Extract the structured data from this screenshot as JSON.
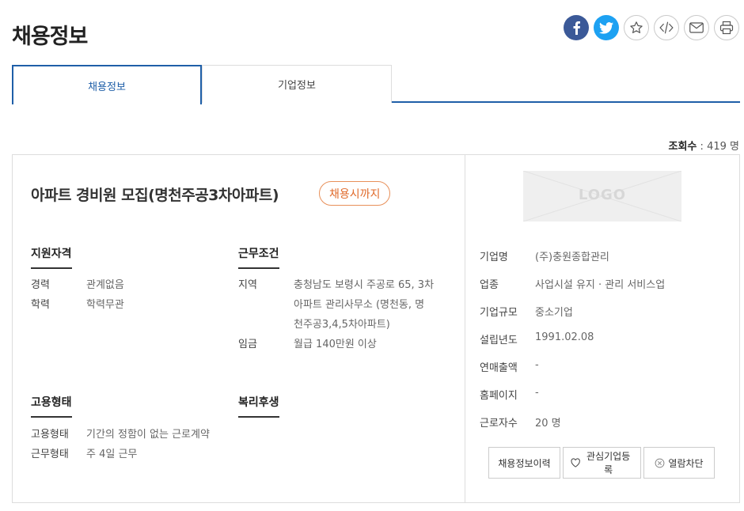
{
  "header": {
    "title": "채용정보"
  },
  "tabs": [
    {
      "label": "채용정보",
      "active": true
    },
    {
      "label": "기업정보",
      "active": false
    }
  ],
  "view_count": {
    "label": "조회수",
    "value": "419",
    "unit": "명"
  },
  "job": {
    "title": "아파트 경비원 모집(명천주공3차아파트)",
    "deadline_badge": "채용시까지"
  },
  "sections": {
    "qualification": {
      "heading": "지원자격",
      "rows": [
        {
          "key": "경력",
          "value": "관계없음"
        },
        {
          "key": "학력",
          "value": "학력무관"
        }
      ]
    },
    "conditions": {
      "heading": "근무조건",
      "rows": [
        {
          "key": "지역",
          "value_lines": [
            "충청남도 보령시 주공로 65, 3차",
            "아파트 관리사무소 (명천동, 명",
            "천주공3,4,5차아파트)"
          ]
        },
        {
          "key": "임금",
          "value": "월급 140만원 이상"
        }
      ]
    },
    "employment": {
      "heading": "고용형태",
      "rows": [
        {
          "key": "고용형태",
          "value": "기간의 정함이 없는 근로계약"
        },
        {
          "key": "근무형태",
          "value": "주 4일 근무"
        }
      ]
    },
    "welfare": {
      "heading": "복리후생"
    }
  },
  "company": {
    "logo_text": "LOGO",
    "rows": [
      {
        "key": "기업명",
        "value": "(주)충원종합관리"
      },
      {
        "key": "업종",
        "value": "사업시설 유지 · 관리 서비스업"
      },
      {
        "key": "기업규모",
        "value": "중소기업"
      },
      {
        "key": "설립년도",
        "value": "1991.02.08"
      },
      {
        "key": "연매출액",
        "value": "-"
      },
      {
        "key": "홈페이지",
        "value": "-"
      },
      {
        "key": "근로자수",
        "value": "20 명"
      }
    ],
    "buttons": {
      "history": "채용정보이력",
      "interest": "관심기업등록",
      "block": "열람차단"
    }
  },
  "colors": {
    "facebook": "#3b5998",
    "twitter": "#1da1f2",
    "tab_accent": "#1f5fa8",
    "badge": "#e06a2a"
  },
  "icons": [
    "facebook-icon",
    "twitter-icon",
    "star-icon",
    "code-icon",
    "mail-icon",
    "print-icon",
    "heart-icon",
    "block-icon"
  ]
}
